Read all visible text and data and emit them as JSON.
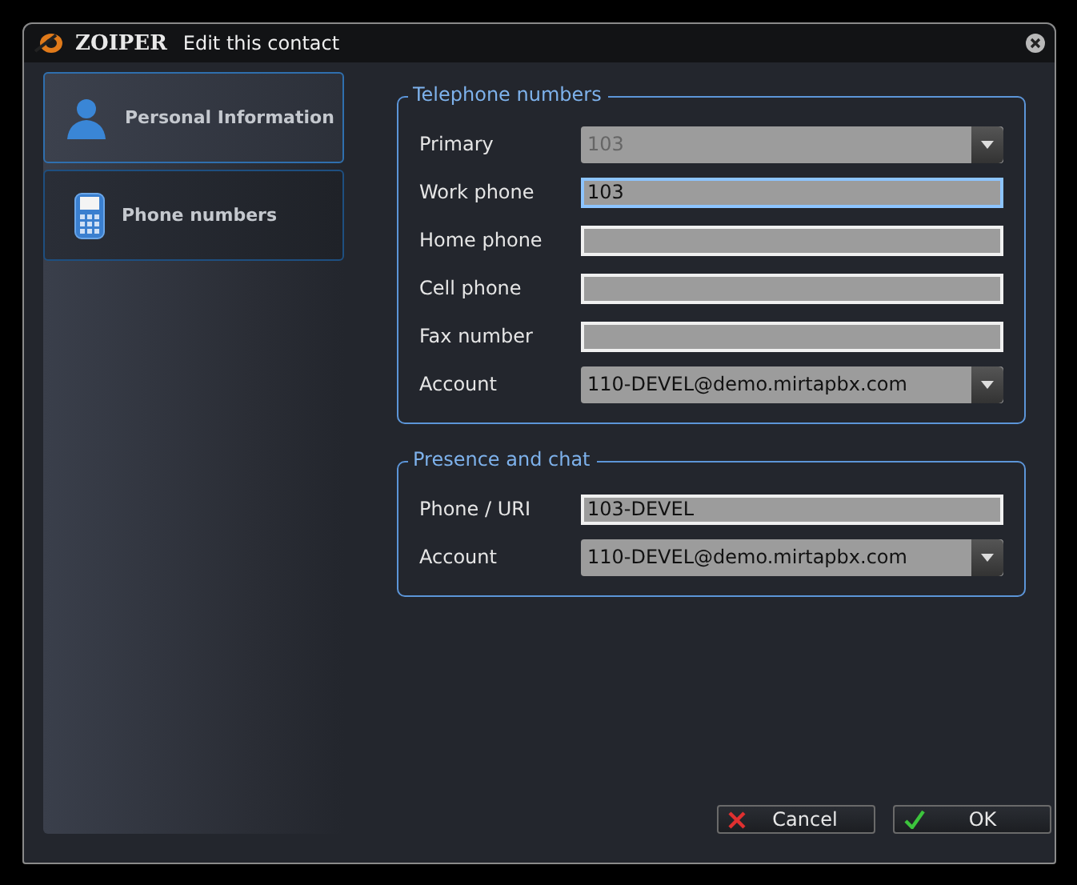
{
  "window": {
    "brand": "ZOIPER",
    "title": "Edit this contact"
  },
  "sidebar": {
    "items": [
      {
        "label": "Personal Information",
        "kind": "person",
        "selected": false
      },
      {
        "label": "Phone numbers",
        "kind": "phone",
        "selected": true
      }
    ]
  },
  "groups": [
    {
      "title": "Telephone numbers",
      "fields": [
        {
          "label": "Primary",
          "kind": "dropdown",
          "value": "103",
          "disabled": true,
          "focused": false
        },
        {
          "label": "Work phone",
          "kind": "text",
          "value": "103",
          "disabled": false,
          "focused": true
        },
        {
          "label": "Home phone",
          "kind": "text",
          "disabled": false,
          "focused": false
        },
        {
          "label": "Cell phone",
          "kind": "text",
          "disabled": false,
          "focused": false
        },
        {
          "label": "Fax number",
          "kind": "text",
          "disabled": false,
          "focused": false
        },
        {
          "label": "Account",
          "kind": "dropdown",
          "value": "110-DEVEL@demo.mirtapbx.com",
          "disabled": false,
          "focused": false
        }
      ]
    },
    {
      "title": "Presence and chat",
      "fields": [
        {
          "label": "Phone / URI",
          "kind": "text",
          "value": "103-DEVEL",
          "disabled": false,
          "focused": false
        },
        {
          "label": "Account",
          "kind": "dropdown",
          "value": "110-DEVEL@demo.mirtapbx.com",
          "disabled": false,
          "focused": false
        }
      ]
    }
  ],
  "buttons": [
    {
      "label": "Cancel",
      "kind": "cancel"
    },
    {
      "label": "OK",
      "kind": "ok"
    }
  ]
}
